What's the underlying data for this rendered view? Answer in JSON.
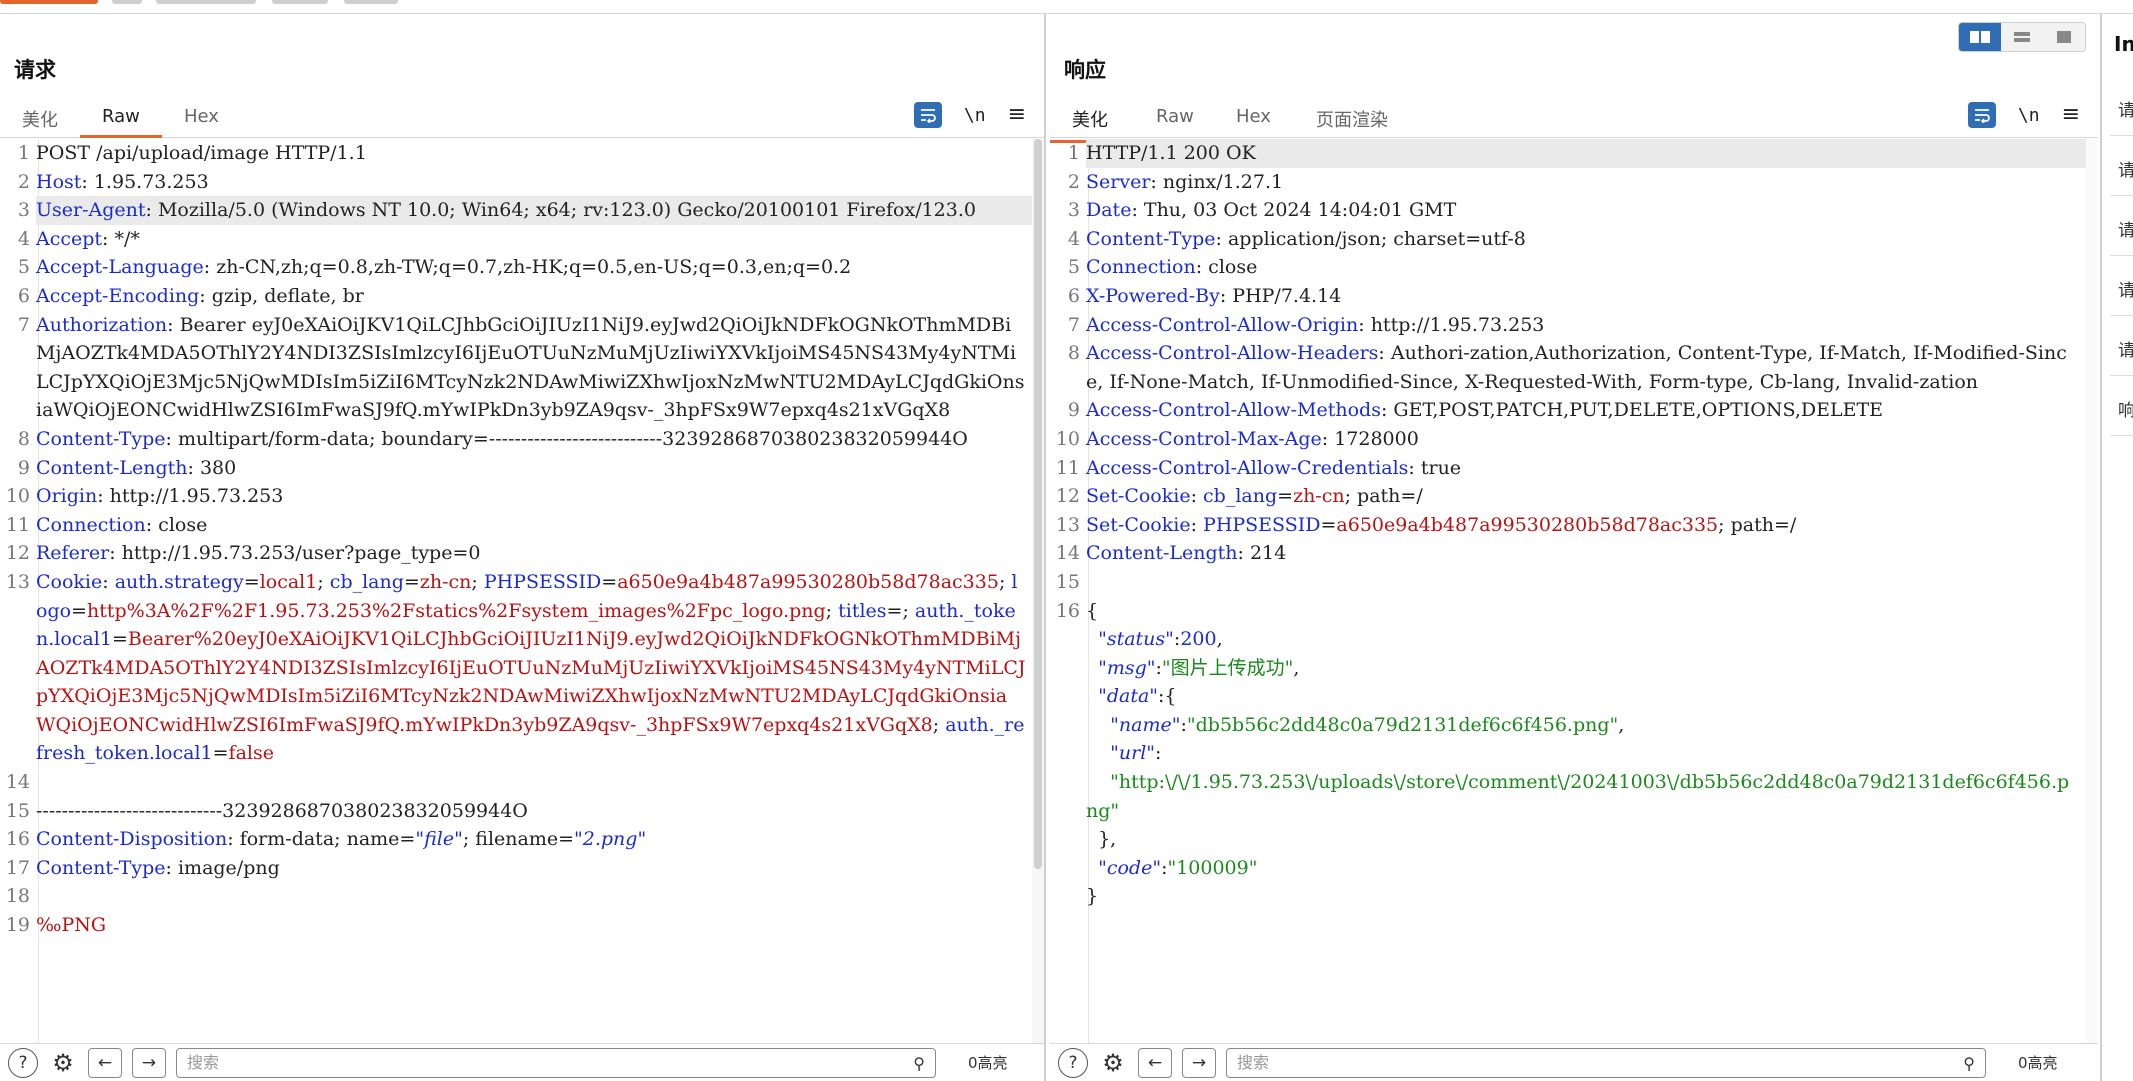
{
  "request": {
    "title": "请求",
    "tabs": [
      "美化",
      "Raw",
      "Hex"
    ],
    "active_tab": "Raw",
    "tools": {
      "newline": "\\n",
      "menu": "≡"
    },
    "lines": [
      {
        "n": "1",
        "parts": [
          [
            "v",
            "POST /api/upload/image HTTP/1.1"
          ]
        ]
      },
      {
        "n": "2",
        "parts": [
          [
            "k",
            "Host"
          ],
          [
            "v",
            ": 1.95.73.253"
          ]
        ]
      },
      {
        "n": "3",
        "parts": [
          [
            "k",
            "User-Agent"
          ],
          [
            "v",
            ": Mozilla/5.0 (Windows NT 10.0; Win64; x64; rv:123.0) Gecko/20100101 Firefox/123.0"
          ]
        ],
        "hl": true
      },
      {
        "n": "4",
        "parts": [
          [
            "k",
            "Accept"
          ],
          [
            "v",
            ": */*"
          ]
        ]
      },
      {
        "n": "5",
        "parts": [
          [
            "k",
            "Accept-Language"
          ],
          [
            "v",
            ": zh-CN,zh;q=0.8,zh-TW;q=0.7,zh-HK;q=0.5,en-US;q=0.3,en;q=0.2"
          ]
        ]
      },
      {
        "n": "6",
        "parts": [
          [
            "k",
            "Accept-Encoding"
          ],
          [
            "v",
            ": gzip, deflate, br"
          ]
        ]
      },
      {
        "n": "7",
        "parts": [
          [
            "k",
            "Authorization"
          ],
          [
            "v",
            ": Bearer eyJ0eXAiOiJKV1QiLCJhbGciOiJIUzI1NiJ9.eyJwd2QiOiJkNDFkOGNkOThmMDBiMjAOZTk4MDA5OThlY2Y4NDI3ZSIsImlzcyI6IjEuOTUuNzMuMjUzIiwiYXVkIjoiMS45NS43My4yNTMiLCJpYXQiOjE3Mjc5NjQwMDIsIm5iZiI6MTcyNzk2NDAwMiwiZXhwIjoxNzMwNTU2MDAyLCJqdGkiOnsiaWQiOjEONCwidHlwZSI6ImFwaSJ9fQ.mYwIPkDn3yb9ZA9qsv-_3hpFSx9W7epxq4s21xVGqX8"
          ]
        ]
      },
      {
        "n": "8",
        "parts": [
          [
            "k",
            "Content-Type"
          ],
          [
            "v",
            ": multipart/form-data; boundary=---------------------------323928687038023832059944O"
          ]
        ]
      },
      {
        "n": "9",
        "parts": [
          [
            "k",
            "Content-Length"
          ],
          [
            "v",
            ": 380"
          ]
        ]
      },
      {
        "n": "10",
        "parts": [
          [
            "k",
            "Origin"
          ],
          [
            "v",
            ": http://1.95.73.253"
          ]
        ]
      },
      {
        "n": "11",
        "parts": [
          [
            "k",
            "Connection"
          ],
          [
            "v",
            ": close"
          ]
        ]
      },
      {
        "n": "12",
        "parts": [
          [
            "k",
            "Referer"
          ],
          [
            "v",
            ": http://1.95.73.253/user?page_type=0"
          ]
        ]
      },
      {
        "n": "13",
        "parts": [
          [
            "k",
            "Cookie"
          ],
          [
            "v",
            ": "
          ],
          [
            "k",
            "auth.strategy"
          ],
          [
            "v",
            "="
          ],
          [
            "r",
            "local1"
          ],
          [
            "v",
            "; "
          ],
          [
            "k",
            "cb_lang"
          ],
          [
            "v",
            "="
          ],
          [
            "r",
            "zh-cn"
          ],
          [
            "v",
            "; "
          ],
          [
            "k",
            "PHPSESSID"
          ],
          [
            "v",
            "="
          ],
          [
            "r",
            "a650e9a4b487a99530280b58d78ac335"
          ],
          [
            "v",
            "; "
          ],
          [
            "k",
            "logo"
          ],
          [
            "v",
            "="
          ],
          [
            "r",
            "http%3A%2F%2F1.95.73.253%2Fstatics%2Fsystem_images%2Fpc_logo.png"
          ],
          [
            "v",
            "; "
          ],
          [
            "k",
            "titles"
          ],
          [
            "v",
            "=; "
          ],
          [
            "k",
            "auth._token.local1"
          ],
          [
            "v",
            "="
          ],
          [
            "r",
            "Bearer%20eyJ0eXAiOiJKV1QiLCJhbGciOiJIUzI1NiJ9.eyJwd2QiOiJkNDFkOGNkOThmMDBiMjAOZTk4MDA5OThlY2Y4NDI3ZSIsImlzcyI6IjEuOTUuNzMuMjUzIiwiYXVkIjoiMS45NS43My4yNTMiLCJpYXQiOjE3Mjc5NjQwMDIsIm5iZiI6MTcyNzk2NDAwMiwiZXhwIjoxNzMwNTU2MDAyLCJqdGkiOnsiaWQiOjEONCwidHlwZSI6ImFwaSJ9fQ.mYwIPkDn3yb9ZA9qsv-_3hpFSx9W7epxq4s21xVGqX8"
          ],
          [
            "v",
            "; "
          ],
          [
            "k",
            "auth._refresh_token.local1"
          ],
          [
            "v",
            "="
          ],
          [
            "r",
            "false"
          ]
        ]
      },
      {
        "n": "14",
        "parts": [
          [
            "v",
            ""
          ]
        ]
      },
      {
        "n": "15",
        "parts": [
          [
            "v",
            "-----------------------------323928687038023832059944O"
          ]
        ]
      },
      {
        "n": "16",
        "parts": [
          [
            "k",
            "Content-Disposition"
          ],
          [
            "v",
            ": form-data; name="
          ],
          [
            "q",
            "\"file\""
          ],
          [
            "v",
            "; filename="
          ],
          [
            "q",
            "\"2.png\""
          ]
        ]
      },
      {
        "n": "17",
        "parts": [
          [
            "k",
            "Content-Type"
          ],
          [
            "v",
            ": image/png"
          ]
        ]
      },
      {
        "n": "18",
        "parts": [
          [
            "v",
            ""
          ]
        ]
      },
      {
        "n": "19",
        "parts": [
          [
            "r",
            "‰PNG"
          ]
        ]
      }
    ],
    "search_placeholder": "搜索",
    "highlight_count": "0高亮"
  },
  "response": {
    "title": "响应",
    "tabs": [
      "美化",
      "Raw",
      "Hex",
      "页面渲染"
    ],
    "active_tab": "美化",
    "tools": {
      "newline": "\\n",
      "menu": "≡"
    },
    "lines": [
      {
        "n": "1",
        "parts": [
          [
            "v",
            "HTTP/1.1 200 OK"
          ]
        ],
        "hl": true
      },
      {
        "n": "2",
        "parts": [
          [
            "k",
            "Server"
          ],
          [
            "v",
            ": nginx/1.27.1"
          ]
        ]
      },
      {
        "n": "3",
        "parts": [
          [
            "k",
            "Date"
          ],
          [
            "v",
            ": Thu, 03 Oct 2024 14:04:01 GMT"
          ]
        ]
      },
      {
        "n": "4",
        "parts": [
          [
            "k",
            "Content-Type"
          ],
          [
            "v",
            ": application/json; charset=utf-8"
          ]
        ]
      },
      {
        "n": "5",
        "parts": [
          [
            "k",
            "Connection"
          ],
          [
            "v",
            ": close"
          ]
        ]
      },
      {
        "n": "6",
        "parts": [
          [
            "k",
            "X-Powered-By"
          ],
          [
            "v",
            ": PHP/7.4.14"
          ]
        ]
      },
      {
        "n": "7",
        "parts": [
          [
            "k",
            "Access-Control-Allow-Origin"
          ],
          [
            "v",
            ": http://1.95.73.253"
          ]
        ]
      },
      {
        "n": "8",
        "parts": [
          [
            "k",
            "Access-Control-Allow-Headers"
          ],
          [
            "v",
            ": Authori-zation,Authorization, Content-Type, If-Match, If-Modified-Since, If-None-Match, If-Unmodified-Since, X-Requested-With, Form-type, Cb-lang, Invalid-zation"
          ]
        ]
      },
      {
        "n": "9",
        "parts": [
          [
            "k",
            "Access-Control-Allow-Methods"
          ],
          [
            "v",
            ": GET,POST,PATCH,PUT,DELETE,OPTIONS,DELETE"
          ]
        ]
      },
      {
        "n": "10",
        "parts": [
          [
            "k",
            "Access-Control-Max-Age"
          ],
          [
            "v",
            ": 1728000"
          ]
        ]
      },
      {
        "n": "11",
        "parts": [
          [
            "k",
            "Access-Control-Allow-Credentials"
          ],
          [
            "v",
            ": true"
          ]
        ]
      },
      {
        "n": "12",
        "parts": [
          [
            "k",
            "Set-Cookie"
          ],
          [
            "v",
            ": "
          ],
          [
            "k",
            "cb_lang"
          ],
          [
            "v",
            "="
          ],
          [
            "r",
            "zh-cn"
          ],
          [
            "v",
            "; path=/"
          ]
        ]
      },
      {
        "n": "13",
        "parts": [
          [
            "k",
            "Set-Cookie"
          ],
          [
            "v",
            ": "
          ],
          [
            "k",
            "PHPSESSID"
          ],
          [
            "v",
            "="
          ],
          [
            "r",
            "a650e9a4b487a99530280b58d78ac335"
          ],
          [
            "v",
            "; path=/"
          ]
        ]
      },
      {
        "n": "14",
        "parts": [
          [
            "k",
            "Content-Length"
          ],
          [
            "v",
            ": 214"
          ]
        ]
      },
      {
        "n": "15",
        "parts": [
          [
            "v",
            ""
          ]
        ]
      },
      {
        "n": "16",
        "parts": [
          [
            "v",
            "{\n  "
          ],
          [
            "q",
            "\"status\""
          ],
          [
            "v",
            ":"
          ],
          [
            "k",
            "200"
          ],
          [
            "v",
            ",\n  "
          ],
          [
            "q",
            "\"msg\""
          ],
          [
            "v",
            ":"
          ],
          [
            "g",
            "\"图片上传成功\""
          ],
          [
            "v",
            ",\n  "
          ],
          [
            "q",
            "\"data\""
          ],
          [
            "v",
            ":{\n    "
          ],
          [
            "q",
            "\"name\""
          ],
          [
            "v",
            ":"
          ],
          [
            "g",
            "\"db5b56c2dd48c0a79d2131def6c6f456.png\""
          ],
          [
            "v",
            ",\n    "
          ],
          [
            "q",
            "\"url\""
          ],
          [
            "v",
            ":\n    "
          ],
          [
            "g",
            "\"http:\\/\\/1.95.73.253\\/uploads\\/store\\/comment\\/20241003\\/db5b56c2dd48c0a79d2131def6c6f456.png\""
          ],
          [
            "v",
            "\n  },\n  "
          ],
          [
            "q",
            "\"code\""
          ],
          [
            "v",
            ":"
          ],
          [
            "g",
            "\"100009\""
          ],
          [
            "v",
            "\n}"
          ]
        ]
      }
    ],
    "search_placeholder": "搜索",
    "highlight_count": "0高亮"
  },
  "inspector": {
    "title": "In",
    "items": [
      "请",
      "请",
      "请",
      "请",
      "请",
      "响"
    ]
  }
}
